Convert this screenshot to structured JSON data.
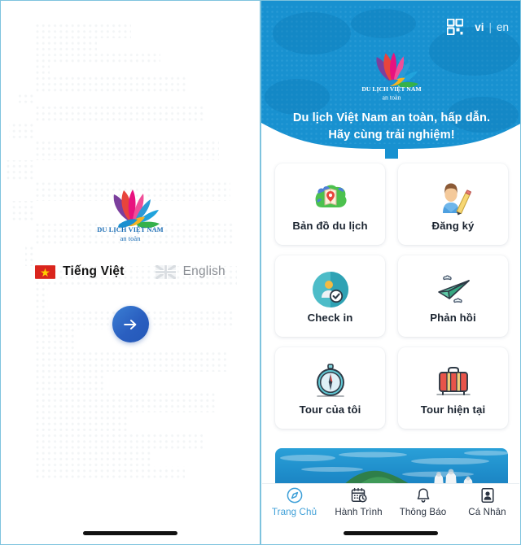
{
  "left_screen": {
    "name": "language-selection-screen",
    "logo": {
      "line1": "DU LỊCH VIỆT NAM",
      "line2": "an toàn",
      "icon": "vietnam-tourism-lotus-logo"
    },
    "languages": [
      {
        "label": "Tiếng Việt",
        "flag": "vietnam-flag",
        "selected": true
      },
      {
        "label": "English",
        "flag": "uk-flag",
        "selected": false
      }
    ],
    "next_button": {
      "icon": "arrow-right-icon",
      "label": ""
    },
    "background": "dotted-world-map-pattern"
  },
  "right_screen": {
    "name": "home-screen",
    "header": {
      "qr_icon": "qr-scan-icon",
      "lang_toggle": {
        "vi": "vi",
        "separator": "|",
        "en": "en"
      },
      "logo": {
        "line1": "DU LỊCH VIỆT NAM",
        "line2": "an toàn",
        "icon": "vietnam-tourism-lotus-logo"
      },
      "title": "Du lịch Việt Nam an toàn, hấp dẫn.\nHãy cùng trải nghiệm!",
      "bg_color": "#1891D0"
    },
    "menu": [
      {
        "label": "Bản đồ du lịch",
        "icon": "travel-map-icon"
      },
      {
        "label": "Đăng ký",
        "icon": "register-person-pencil-icon"
      },
      {
        "label": "Check in",
        "icon": "check-in-icon"
      },
      {
        "label": "Phản hồi",
        "icon": "paper-plane-feedback-icon"
      },
      {
        "label": "Tour của tôi",
        "icon": "compass-icon"
      },
      {
        "label": "Tour hiện tại",
        "icon": "suitcase-icon"
      }
    ],
    "banner": {
      "alt": "sea-and-mountain-landscape-photo"
    },
    "tabs": [
      {
        "label": "Trang Chủ",
        "icon": "compass-home-icon",
        "active": true
      },
      {
        "label": "Hành Trình",
        "icon": "calendar-clock-icon",
        "active": false
      },
      {
        "label": "Thông Báo",
        "icon": "bell-icon",
        "active": false
      },
      {
        "label": "Cá Nhân",
        "icon": "person-card-icon",
        "active": false
      }
    ],
    "accent_color": "#3FA0D8"
  }
}
